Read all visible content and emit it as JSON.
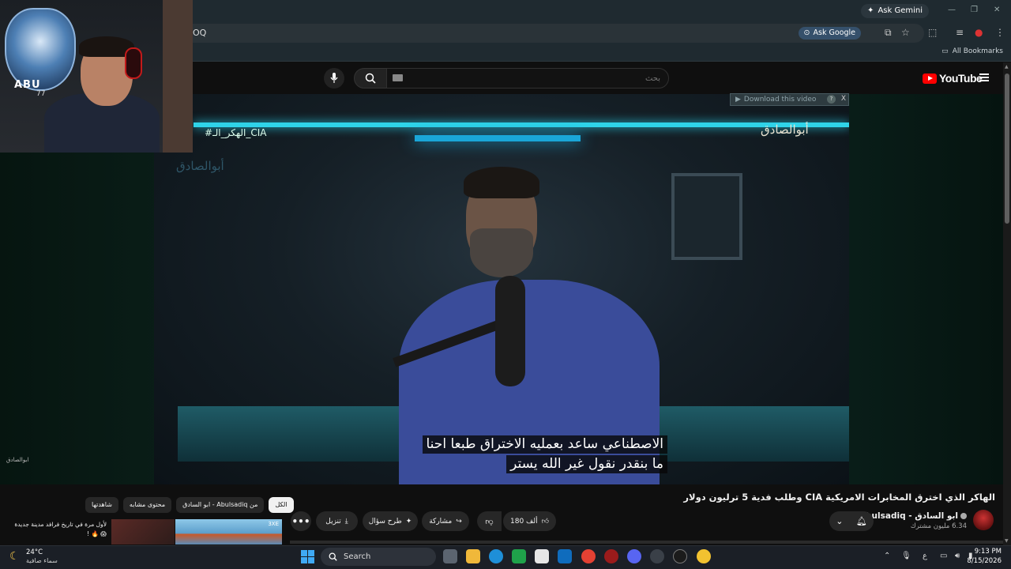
{
  "browser": {
    "ask_gemini": "Ask Gemini",
    "address_text": "OQ",
    "ask_google": "Ask Google",
    "all_bookmarks": "All Bookmarks",
    "window_controls": [
      "—",
      "❐",
      "✕"
    ]
  },
  "youtube": {
    "search_placeholder": "بحث",
    "logo_text": "YouTube",
    "download_bar_text": "Download this video",
    "download_help": "?",
    "download_close": "X"
  },
  "video": {
    "hashtag": "#الهكر_الـ_CIA",
    "logo": "أبوالصادق",
    "caption_line1": "الاصطناعي ساعد بعمليه الاختراق طبعا احنا",
    "caption_line2": "ما بنقدر نقول غير الله يستر",
    "watermark_small": "ابوالصادق"
  },
  "webcam": {
    "brand": "ABU",
    "brand_sub": "77"
  },
  "details": {
    "title": "الهاكر الذي اخترق المخابرات الامريكية CIA وطلب فدية 5 ترليون دولار",
    "channel": "ابو السادق - Abulsadiq",
    "subscribers": "6.34 مليون مشترك",
    "likes": "180 ألف",
    "share": "مشاركة",
    "ask": "طرح سؤال",
    "download": "تنزيل",
    "more": "•••"
  },
  "chips": [
    {
      "label": "الكل",
      "active": true
    },
    {
      "label": "من Abulsadiq - ابو السادق",
      "active": false
    },
    {
      "label": "محتوى مشابه",
      "active": false
    },
    {
      "label": "شاهدتها",
      "active": false
    }
  ],
  "recommendation": {
    "title": "لأول مرة في تاريخ فرافد مدينة جديدة 😱 🔥 !",
    "thumb_tag": "3XE"
  },
  "taskbar": {
    "temperature": "24°C",
    "weather": "سماء صافية",
    "search": "Search",
    "time": "9:13 PM",
    "date": "8/15/2026",
    "lang": "ع"
  },
  "colors": {
    "accent_red": "#ff0000",
    "neon_cyan": "#2fd3e8",
    "pill_bg": "#272727"
  }
}
